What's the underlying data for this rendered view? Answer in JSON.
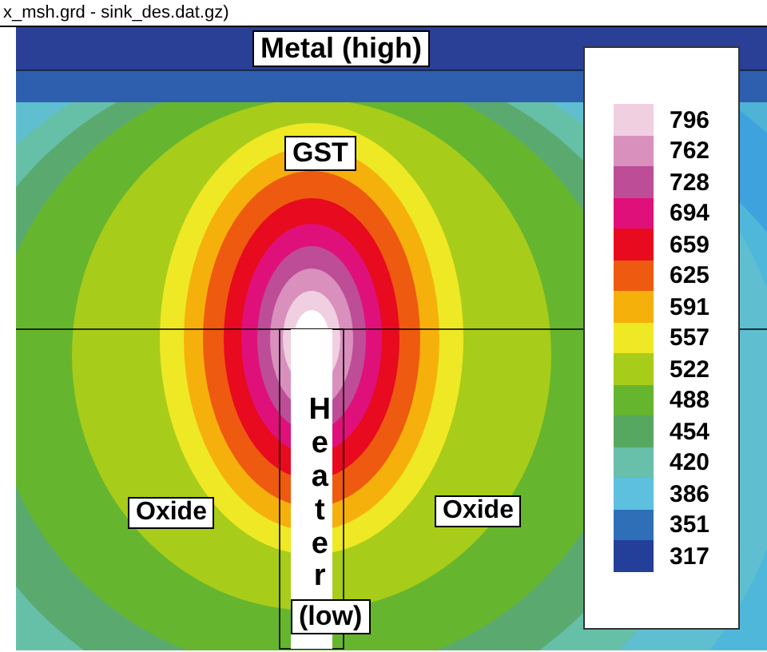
{
  "window": {
    "title": "x_msh.grd - sink_des.dat.gz)"
  },
  "plot": {
    "labels": [
      {
        "kind": "box",
        "text": "Metal (high)"
      },
      {
        "kind": "box",
        "text": "GST"
      },
      {
        "kind": "vertical",
        "text": "Heater"
      },
      {
        "kind": "box",
        "text": "(low)"
      },
      {
        "kind": "box",
        "text": "Oxide"
      },
      {
        "kind": "box",
        "text": "Oxide"
      }
    ]
  },
  "legend": {
    "entries": [
      {
        "label": "796",
        "color": "#f0cfe0"
      },
      {
        "label": "762",
        "color": "#d990bd"
      },
      {
        "label": "728",
        "color": "#bd4d97"
      },
      {
        "label": "694",
        "color": "#e0107a"
      },
      {
        "label": "659",
        "color": "#e80a1e"
      },
      {
        "label": "625",
        "color": "#ee5a10"
      },
      {
        "label": "591",
        "color": "#f6b00c"
      },
      {
        "label": "557",
        "color": "#eee825"
      },
      {
        "label": "522",
        "color": "#a8cc1a"
      },
      {
        "label": "488",
        "color": "#66b52e"
      },
      {
        "label": "454",
        "color": "#56a860"
      },
      {
        "label": "420",
        "color": "#68bfaa"
      },
      {
        "label": "386",
        "color": "#5cc0de"
      },
      {
        "label": "351",
        "color": "#2e6fb8"
      },
      {
        "label": "317",
        "color": "#233f9a"
      }
    ]
  }
}
